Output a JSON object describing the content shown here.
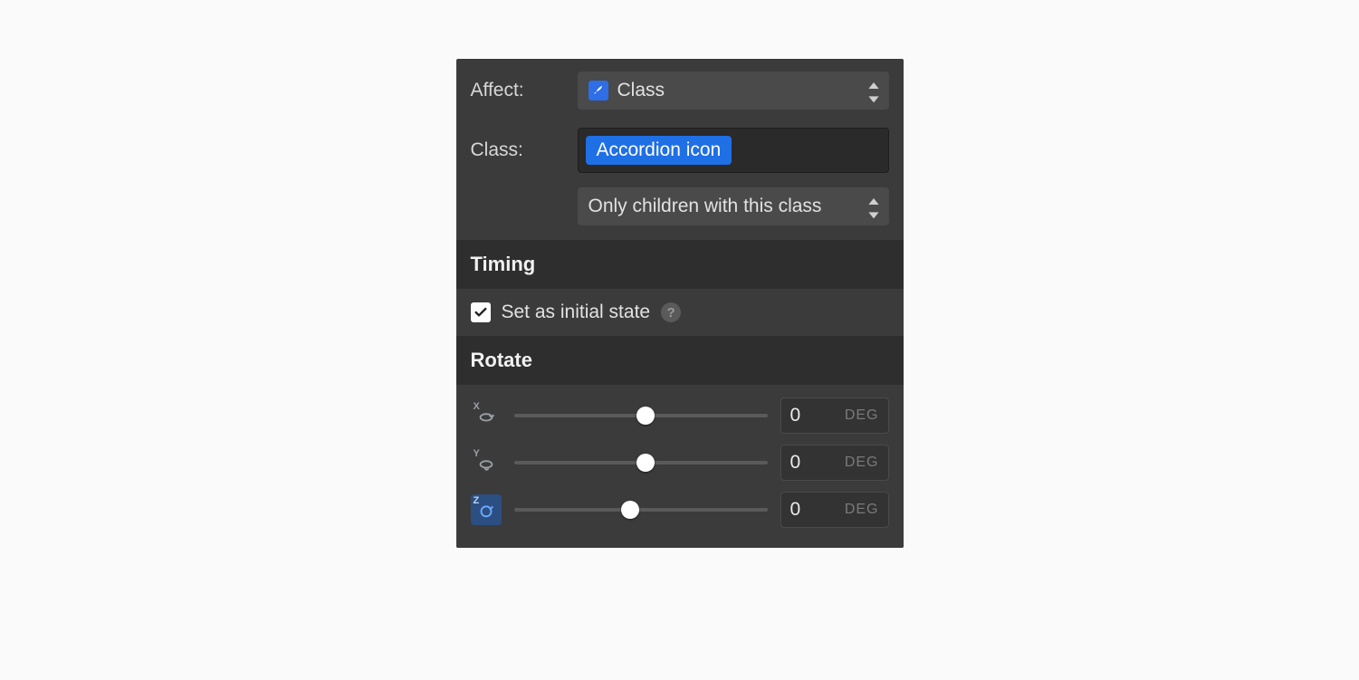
{
  "affect": {
    "label": "Affect:",
    "value": "Class",
    "icon_name": "brush-icon"
  },
  "class": {
    "label": "Class:",
    "token": "Accordion icon"
  },
  "scope": {
    "value": "Only children with this class"
  },
  "sections": {
    "timing": "Timing",
    "rotate": "Rotate"
  },
  "initial_state": {
    "label": "Set as initial state",
    "checked": true,
    "help_glyph": "?"
  },
  "rotate": {
    "axes": [
      {
        "axis": "X",
        "value": "0",
        "unit": "DEG",
        "active": false,
        "pos_pct": 52
      },
      {
        "axis": "Y",
        "value": "0",
        "unit": "DEG",
        "active": false,
        "pos_pct": 52
      },
      {
        "axis": "Z",
        "value": "0",
        "unit": "DEG",
        "active": true,
        "pos_pct": 46
      }
    ]
  }
}
